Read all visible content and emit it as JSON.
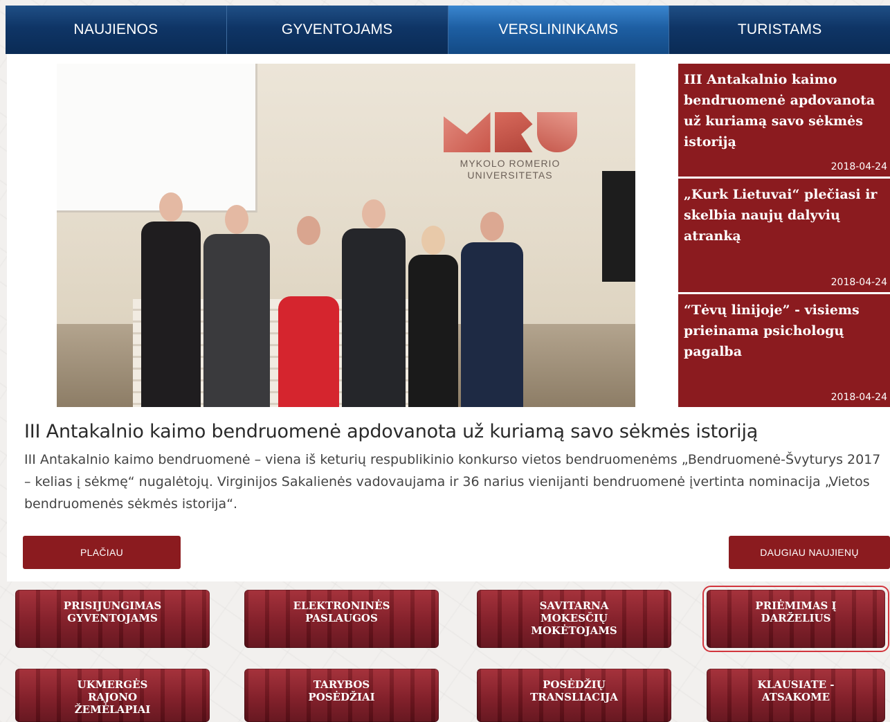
{
  "nav": {
    "items": [
      "NAUJIENOS",
      "GYVENTOJAMS",
      "VERSLININKAMS",
      "TURISTAMS"
    ]
  },
  "hero": {
    "logo_line1": "MYKOLO ROMERIO",
    "logo_line2": "UNIVERSITETAS"
  },
  "news": [
    {
      "title": "III Antakalnio kaimo bendruomenė apdovanota už kuriamą savo sėkmės istoriją",
      "date": "2018-04-24"
    },
    {
      "title": "„Kurk Lietuvai“ plečiasi ir skelbia naujų dalyvių atranką",
      "date": "2018-04-24"
    },
    {
      "title": "“Tėvų linijoje” - visiems prieinama psichologų pagalba",
      "date": "2018-04-24"
    }
  ],
  "article": {
    "title": "III Antakalnio kaimo bendruomenė apdovanota už kuriamą savo sėkmės istoriją",
    "text": "III Antakalnio kaimo bendruomenė – viena iš keturių respublikinio konkurso vietos bendruomenėms  „Bendruomenė-Švyturys 2017 – kelias į sėkmę“ nugalėtojų. Virginijos Sakalienės vadovaujama ir 36 narius vienijanti bendruomenė įvertinta nominacija „Vietos bendruomenės sėkmės istorija“."
  },
  "buttons": {
    "more": "PLAČIAU",
    "all_news": "DAUGIAU NAUJIENŲ"
  },
  "tiles": [
    "PRISIJUNGIMAS\nGYVENTOJAMS",
    "ELEKTRONINĖS\nPASLAUGOS",
    "SAVITARNA\nMOKESČIŲ\nMOKĖTOJAMS",
    "PRIĖMIMAS Į\nDARŽELIUS",
    "UKMERGĖS\nRAJONO\nŽEMĖLAPIAI",
    "TARYBOS\nPOSĖDŽIAI",
    "POSĖDŽIŲ\nTRANSLIACIJA",
    "KLAUSIATE -\nATSAKOME"
  ],
  "colors": {
    "nav_dark": "#0f3566",
    "nav_active": "#1e5fa3",
    "brand_red": "#8b1b1f",
    "highlight_outline": "#d2353d"
  }
}
